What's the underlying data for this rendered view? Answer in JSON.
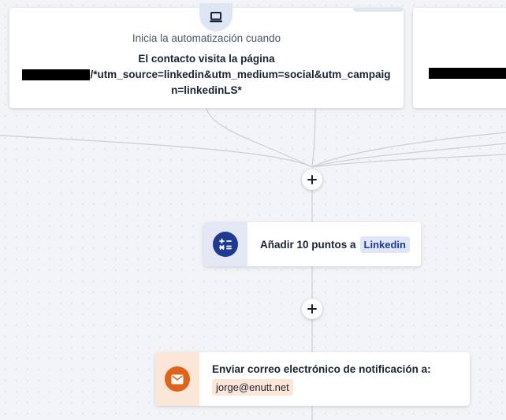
{
  "trigger": {
    "icon": "laptop-icon",
    "label": "Inicia la automatización cuando",
    "text_line1": "El contacto visita la página",
    "text_rest": "/*utm_source=linkedin&utm_medium=social&utm_campaign=linkedinLS*"
  },
  "step_points": {
    "icon": "calculator-icon",
    "text": "Añadir 10 puntos a",
    "tag": "Linkedin",
    "colors": {
      "accent": "#1f3a93",
      "tint": "#e3e8f4"
    }
  },
  "step_email": {
    "icon": "email-icon",
    "text": "Enviar correo electrónico de notificación a:",
    "tag": "jorge@enutt.net",
    "colors": {
      "accent": "#e0631b",
      "tint": "#fbe6d8"
    }
  },
  "add_step": {
    "icon": "plus-icon"
  }
}
